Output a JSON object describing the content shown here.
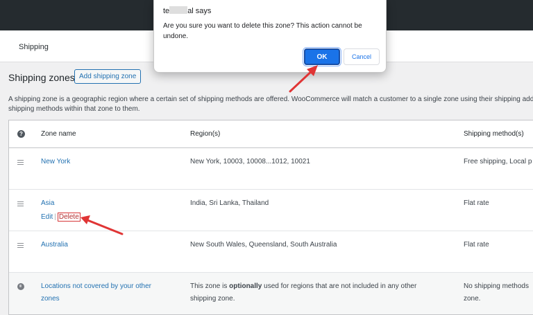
{
  "header": {
    "title": "Shipping"
  },
  "zones": {
    "heading": "Shipping zones",
    "add_button": "Add shipping zone",
    "description_line1": "A shipping zone is a geographic region where a certain set of shipping methods are offered. WooCommerce will match a customer to a single zone using their shipping address",
    "description_line2": "shipping methods within that zone to them."
  },
  "table": {
    "headers": {
      "help": "?",
      "name": "Zone name",
      "region": "Region(s)",
      "methods": "Shipping method(s)"
    },
    "rows": [
      {
        "name": "New York",
        "region": "New York, 10003, 10008...1012, 10021",
        "methods": "Free shipping, Local p"
      },
      {
        "name": "Asia",
        "region": "India, Sri Lanka, Thailand",
        "methods": "Flat rate",
        "action_edit": "Edit",
        "action_sep": "|",
        "action_delete": "Delete"
      },
      {
        "name": "Australia",
        "region": "New South Wales, Queensland, South Australia",
        "methods": "Flat rate"
      }
    ],
    "fallback": {
      "name_line1": "Locations not covered by your other",
      "name_line2": "zones",
      "region_pre": "This zone is ",
      "region_bold": "optionally",
      "region_post": " used for regions that are not included in any other",
      "region_line2": "shipping zone.",
      "methods_line1": "No shipping methods",
      "methods_line2": "zone."
    }
  },
  "dialog": {
    "title_prefix": "te",
    "title_suffix": "al says",
    "message": "Are you sure you want to delete this zone? This action cannot be undone.",
    "ok_label": "OK",
    "cancel_label": "Cancel"
  },
  "colors": {
    "accent": "#2271b1",
    "dialog_primary": "#1a73e8",
    "annotation_arrow": "#e03535"
  }
}
